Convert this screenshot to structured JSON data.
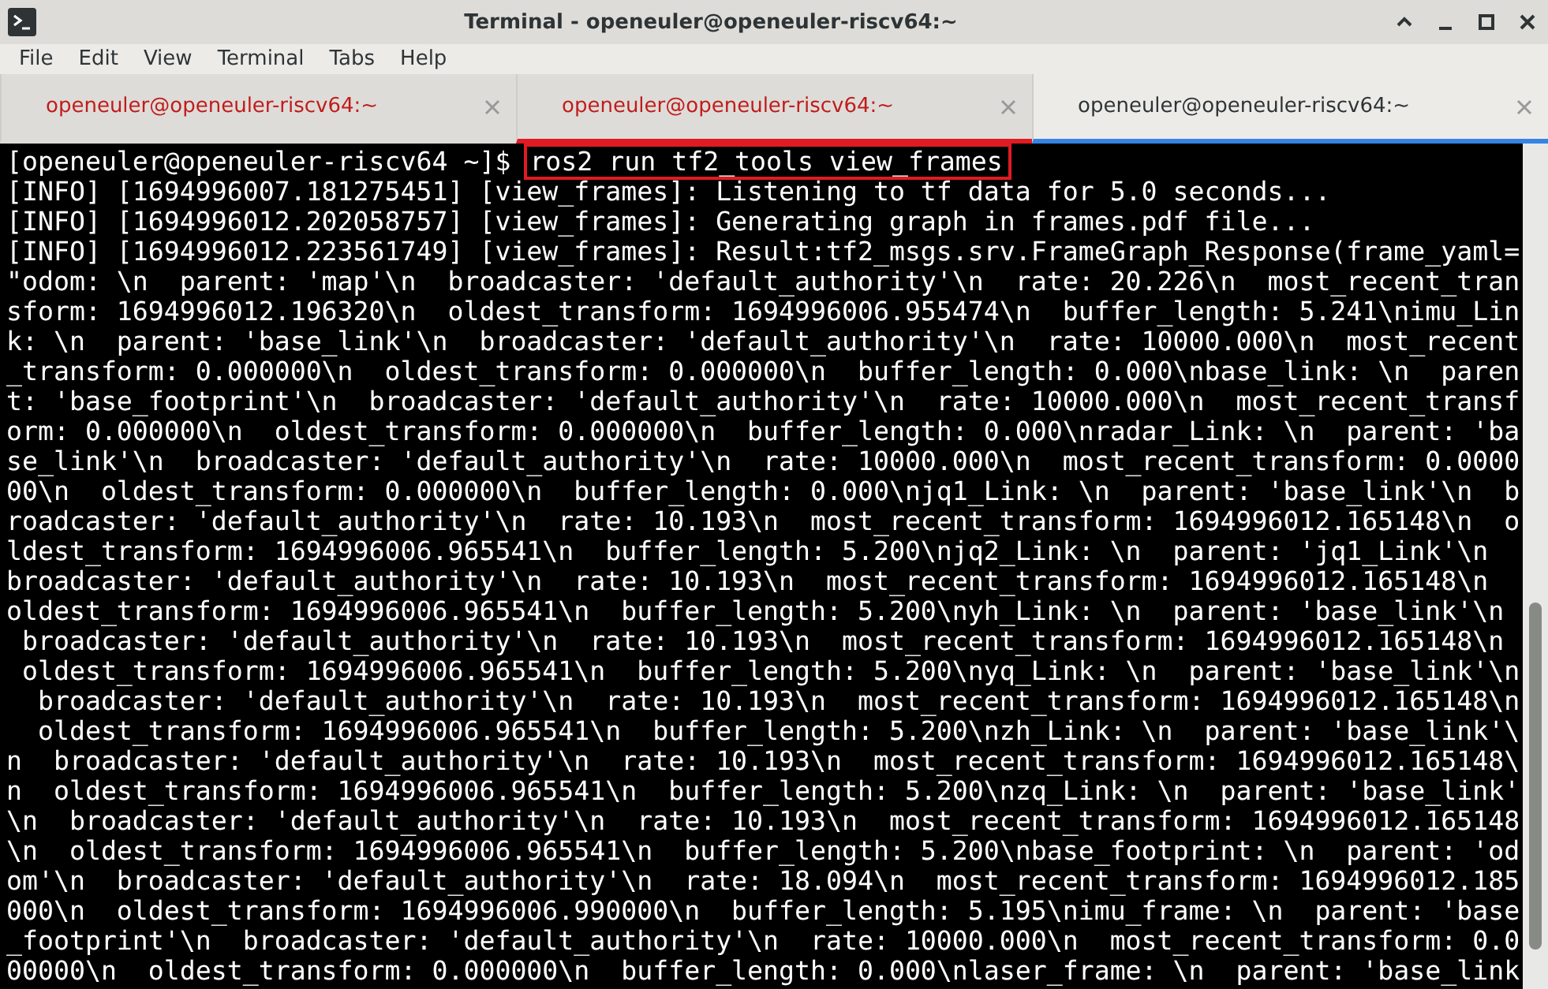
{
  "window": {
    "title": "Terminal - openeuler@openeuler-riscv64:~"
  },
  "menu": [
    "File",
    "Edit",
    "View",
    "Terminal",
    "Tabs",
    "Help"
  ],
  "tabs": [
    {
      "label": "openeuler@openeuler-riscv64:~",
      "selected": false,
      "activity": true,
      "highlighted": false
    },
    {
      "label": "openeuler@openeuler-riscv64:~",
      "selected": false,
      "activity": true,
      "highlighted": true
    },
    {
      "label": "openeuler@openeuler-riscv64:~",
      "selected": true,
      "activity": false,
      "highlighted": false
    }
  ],
  "terminal": {
    "prompt": "[openeuler@openeuler-riscv64 ~]$ ",
    "command": "ros2 run tf2_tools view_frames",
    "command_highlighted": true,
    "lines": [
      "[INFO] [1694996007.181275451] [view_frames]: Listening to tf data for 5.0 seconds...",
      "[INFO] [1694996012.202058757] [view_frames]: Generating graph in frames.pdf file...",
      "[INFO] [1694996012.223561749] [view_frames]: Result:tf2_msgs.srv.FrameGraph_Response(frame_yaml=",
      "\"odom: \\n  parent: 'map'\\n  broadcaster: 'default_authority'\\n  rate: 20.226\\n  most_recent_tran",
      "sform: 1694996012.196320\\n  oldest_transform: 1694996006.955474\\n  buffer_length: 5.241\\nimu_Lin",
      "k: \\n  parent: 'base_link'\\n  broadcaster: 'default_authority'\\n  rate: 10000.000\\n  most_recent",
      "_transform: 0.000000\\n  oldest_transform: 0.000000\\n  buffer_length: 0.000\\nbase_link: \\n  paren",
      "t: 'base_footprint'\\n  broadcaster: 'default_authority'\\n  rate: 10000.000\\n  most_recent_transf",
      "orm: 0.000000\\n  oldest_transform: 0.000000\\n  buffer_length: 0.000\\nradar_Link: \\n  parent: 'ba",
      "se_link'\\n  broadcaster: 'default_authority'\\n  rate: 10000.000\\n  most_recent_transform: 0.0000",
      "00\\n  oldest_transform: 0.000000\\n  buffer_length: 0.000\\njq1_Link: \\n  parent: 'base_link'\\n  b",
      "roadcaster: 'default_authority'\\n  rate: 10.193\\n  most_recent_transform: 1694996012.165148\\n  o",
      "ldest_transform: 1694996006.965541\\n  buffer_length: 5.200\\njq2_Link: \\n  parent: 'jq1_Link'\\n",
      "broadcaster: 'default_authority'\\n  rate: 10.193\\n  most_recent_transform: 1694996012.165148\\n",
      "oldest_transform: 1694996006.965541\\n  buffer_length: 5.200\\nyh_Link: \\n  parent: 'base_link'\\n",
      " broadcaster: 'default_authority'\\n  rate: 10.193\\n  most_recent_transform: 1694996012.165148\\n",
      " oldest_transform: 1694996006.965541\\n  buffer_length: 5.200\\nyq_Link: \\n  parent: 'base_link'\\n",
      "  broadcaster: 'default_authority'\\n  rate: 10.193\\n  most_recent_transform: 1694996012.165148\\n",
      "  oldest_transform: 1694996006.965541\\n  buffer_length: 5.200\\nzh_Link: \\n  parent: 'base_link'\\",
      "n  broadcaster: 'default_authority'\\n  rate: 10.193\\n  most_recent_transform: 1694996012.165148\\",
      "n  oldest_transform: 1694996006.965541\\n  buffer_length: 5.200\\nzq_Link: \\n  parent: 'base_link'",
      "\\n  broadcaster: 'default_authority'\\n  rate: 10.193\\n  most_recent_transform: 1694996012.165148",
      "\\n  oldest_transform: 1694996006.965541\\n  buffer_length: 5.200\\nbase_footprint: \\n  parent: 'od",
      "om'\\n  broadcaster: 'default_authority'\\n  rate: 18.094\\n  most_recent_transform: 1694996012.185",
      "000\\n  oldest_transform: 1694996006.990000\\n  buffer_length: 5.195\\nimu_frame: \\n  parent: 'base",
      "_footprint'\\n  broadcaster: 'default_authority'\\n  rate: 10000.000\\n  most_recent_transform: 0.0",
      "00000\\n  oldest_transform: 0.000000\\n  buffer_length: 0.000\\nlaser_frame: \\n  parent: 'base_link"
    ]
  }
}
